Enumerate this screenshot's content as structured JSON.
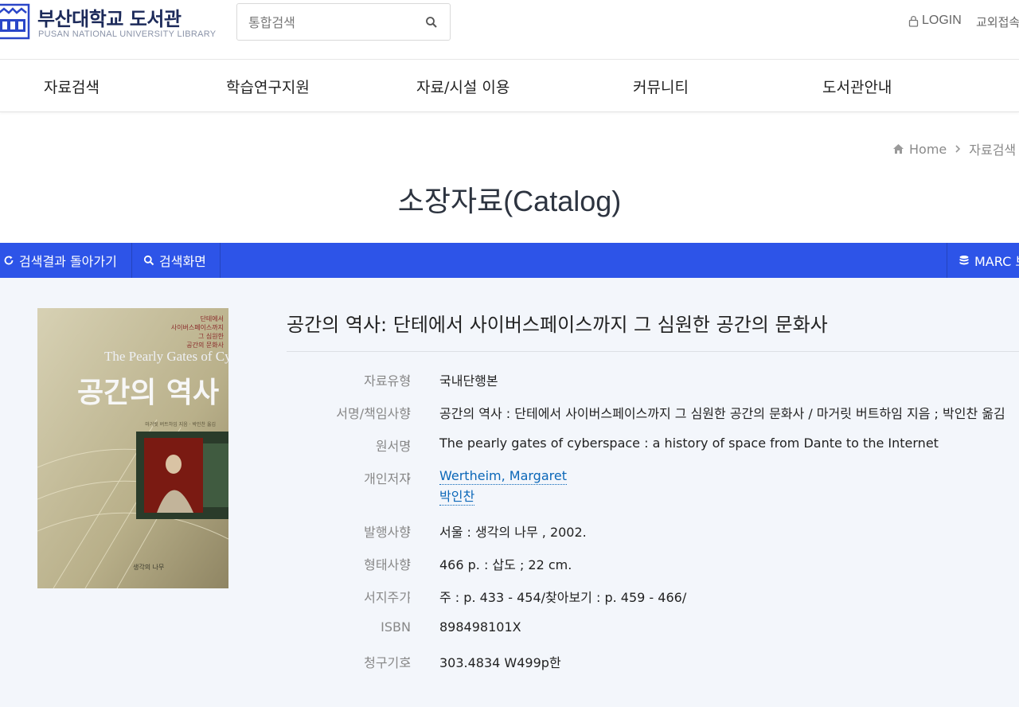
{
  "header": {
    "logo_title": "부산대학교 도서관",
    "logo_subtitle": "PUSAN NATIONAL UNIVERSITY LIBRARY",
    "search_placeholder": "통합검색",
    "login_label": "LOGIN",
    "extra_link": "교외접속"
  },
  "nav": {
    "items": [
      {
        "label": "자료검색"
      },
      {
        "label": "학습연구지원"
      },
      {
        "label": "자료/시설 이용"
      },
      {
        "label": "커뮤니티"
      },
      {
        "label": "도서관안내"
      }
    ]
  },
  "breadcrumb": {
    "home": "Home",
    "current": "자료검색"
  },
  "page_title": "소장자료(Catalog)",
  "toolbar": {
    "back_label": "검색결과 돌아가기",
    "search_label": "검색화면",
    "marc_label": "MARC 보기"
  },
  "record": {
    "cover": {
      "top_text": "단테에서 사이버스페이스까지 그 심원한 공간의 문화사",
      "en_title": "The Pearly Gates of Cyberspace",
      "ko_title": "공간의 역사",
      "author_line": "마거릿 버트하임 지음 · 박인찬 옮김",
      "publisher_mark": "생각의 나무"
    },
    "title": "공간의 역사: 단테에서 사이버스페이스까지 그 심원한 공간의 문화사",
    "fields": {
      "type": {
        "label": "자료유형",
        "value": "국내단행본"
      },
      "statement": {
        "label": "서명/책임사항",
        "value": "공간의 역사 : 단테에서 사이버스페이스까지 그 심원한 공간의 문화사 / 마거릿 버트하임 지음 ; 박인찬 옮김"
      },
      "original_title": {
        "label": "원서명",
        "value": "The pearly gates of cyberspace : a history of space from Dante to the Internet"
      },
      "authors": {
        "label": "개인저자",
        "values": [
          "Wertheim, Margaret",
          "박인찬"
        ]
      },
      "publication": {
        "label": "발행사항",
        "value": "서울 : 생각의 나무 , 2002."
      },
      "physical": {
        "label": "형태사항",
        "value": "466 p. : 삽도 ; 22 cm."
      },
      "notes": {
        "label": "서지주기",
        "value": "주 : p. 433 - 454/찾아보기 : p. 459 - 466/"
      },
      "isbn": {
        "label": "ISBN",
        "value": "898498101X"
      },
      "call_number": {
        "label": "청구기호",
        "value": "303.4834 W499p한"
      }
    }
  },
  "colors": {
    "toolbar": "#2d54e8",
    "content_bg": "#f3f6fb",
    "link": "#0b67b8",
    "logo": "#1c2a5a"
  }
}
